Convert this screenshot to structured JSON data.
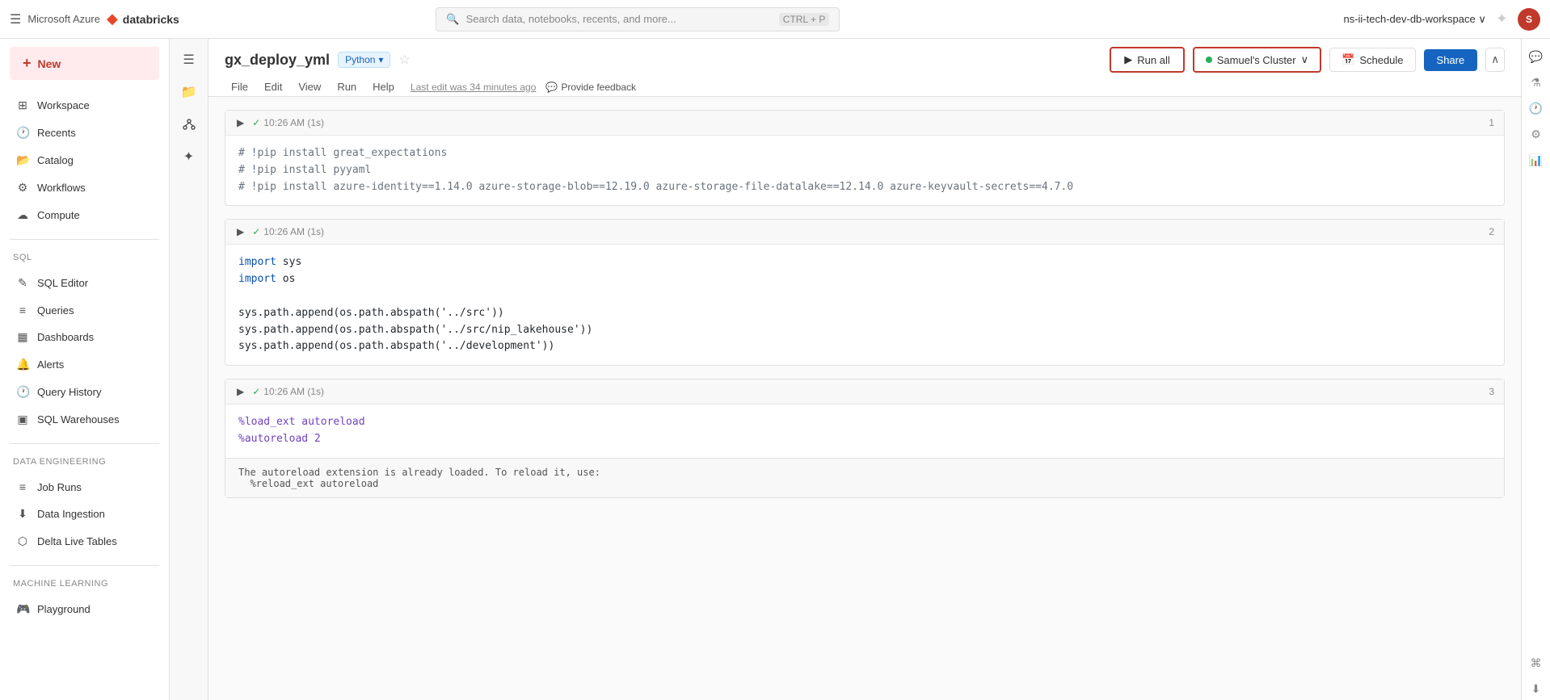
{
  "topbar": {
    "hamburger_label": "☰",
    "azure_text": "Microsoft Azure",
    "db_icon": "◆",
    "db_text": "databricks",
    "search_placeholder": "Search data, notebooks, recents, and more...",
    "search_shortcut": "CTRL + P",
    "workspace_name": "ns-ii-tech-dev-db-workspace ∨",
    "spark_icon": "✦",
    "avatar_text": "S"
  },
  "sidebar": {
    "new_label": "New",
    "new_plus": "+",
    "nav_items": [
      {
        "icon": "◫",
        "label": "Workspace"
      },
      {
        "icon": "🕐",
        "label": "Recents"
      },
      {
        "icon": "📂",
        "label": "Catalog"
      },
      {
        "icon": "⚙",
        "label": "Workflows"
      },
      {
        "icon": "☁",
        "label": "Compute"
      }
    ],
    "sql_section": "SQL",
    "sql_items": [
      {
        "icon": "✎",
        "label": "SQL Editor"
      },
      {
        "icon": "≡",
        "label": "Queries"
      },
      {
        "icon": "▦",
        "label": "Dashboards"
      },
      {
        "icon": "🔔",
        "label": "Alerts"
      },
      {
        "icon": "🕐",
        "label": "Query History"
      },
      {
        "icon": "▣",
        "label": "SQL Warehouses"
      }
    ],
    "data_eng_section": "Data Engineering",
    "data_eng_items": [
      {
        "icon": "≡",
        "label": "Job Runs"
      },
      {
        "icon": "⬇",
        "label": "Data Ingestion"
      },
      {
        "icon": "⬡",
        "label": "Delta Live Tables"
      }
    ],
    "ml_section": "Machine Learning",
    "ml_items": [
      {
        "icon": "🎮",
        "label": "Playground"
      }
    ]
  },
  "icon_sidebar": {
    "items": [
      {
        "icon": "☰",
        "name": "menu-icon"
      },
      {
        "icon": "📁",
        "name": "folder-icon"
      },
      {
        "icon": "⚡",
        "name": "cluster-icon"
      },
      {
        "icon": "✦",
        "name": "ai-icon"
      }
    ]
  },
  "notebook": {
    "title": "gx_deploy_yml",
    "language": "Python",
    "star": "☆",
    "menu": [
      "File",
      "Edit",
      "View",
      "Run",
      "Help"
    ],
    "last_edit": "Last edit was 34 minutes ago",
    "feedback_icon": "💬",
    "feedback_label": "Provide feedback"
  },
  "toolbar": {
    "run_all_label": "Run all",
    "run_icon": "▶",
    "cluster_name": "Samuel's Cluster",
    "cluster_chevron": "∨",
    "schedule_icon": "📅",
    "schedule_label": "Schedule",
    "share_label": "Share",
    "collapse_icon": "∧"
  },
  "cells": [
    {
      "number": "1",
      "status_icon": "✓",
      "time": "10:26 AM (1s)",
      "lines": [
        {
          "type": "comment",
          "text": "# !pip install great_expectations"
        },
        {
          "type": "comment",
          "text": "# !pip install pyyaml"
        },
        {
          "type": "comment",
          "text": "# !pip install azure-identity==1.14.0 azure-storage-blob==12.19.0 azure-storage-file-datalake==12.14.0 azure-keyvault-secrets==4.7.0"
        }
      ],
      "output": null
    },
    {
      "number": "2",
      "status_icon": "✓",
      "time": "10:26 AM (1s)",
      "lines": [
        {
          "type": "keyword",
          "text": "import ",
          "rest": "sys"
        },
        {
          "type": "keyword",
          "text": "import ",
          "rest": "os"
        },
        {
          "type": "blank",
          "text": ""
        },
        {
          "type": "normal",
          "text": "sys.path.append(os.path.abspath('../src'))"
        },
        {
          "type": "normal",
          "text": "sys.path.append(os.path.abspath('../src/nip_lakehouse'))"
        },
        {
          "type": "normal",
          "text": "sys.path.append(os.path.abspath('../development'))"
        }
      ],
      "output": null
    },
    {
      "number": "3",
      "status_icon": "✓",
      "time": "10:26 AM (1s)",
      "lines": [
        {
          "type": "magic",
          "text": "%load_ext autoreload"
        },
        {
          "type": "magic",
          "text": "%autoreload 2"
        }
      ],
      "output": "The autoreload extension is already loaded. To reload it, use:\n  %reload_ext autoreload"
    }
  ],
  "right_panel": {
    "items": [
      {
        "icon": "💬",
        "name": "comments-icon"
      },
      {
        "icon": "⚗",
        "name": "experiment-icon"
      },
      {
        "icon": "🕐",
        "name": "history-icon"
      },
      {
        "icon": "⚙",
        "name": "settings-icon"
      },
      {
        "icon": "📊",
        "name": "chart-icon"
      },
      {
        "icon": "⌘",
        "name": "keyboard-icon"
      },
      {
        "icon": "⬇",
        "name": "collapse-icon"
      }
    ]
  }
}
